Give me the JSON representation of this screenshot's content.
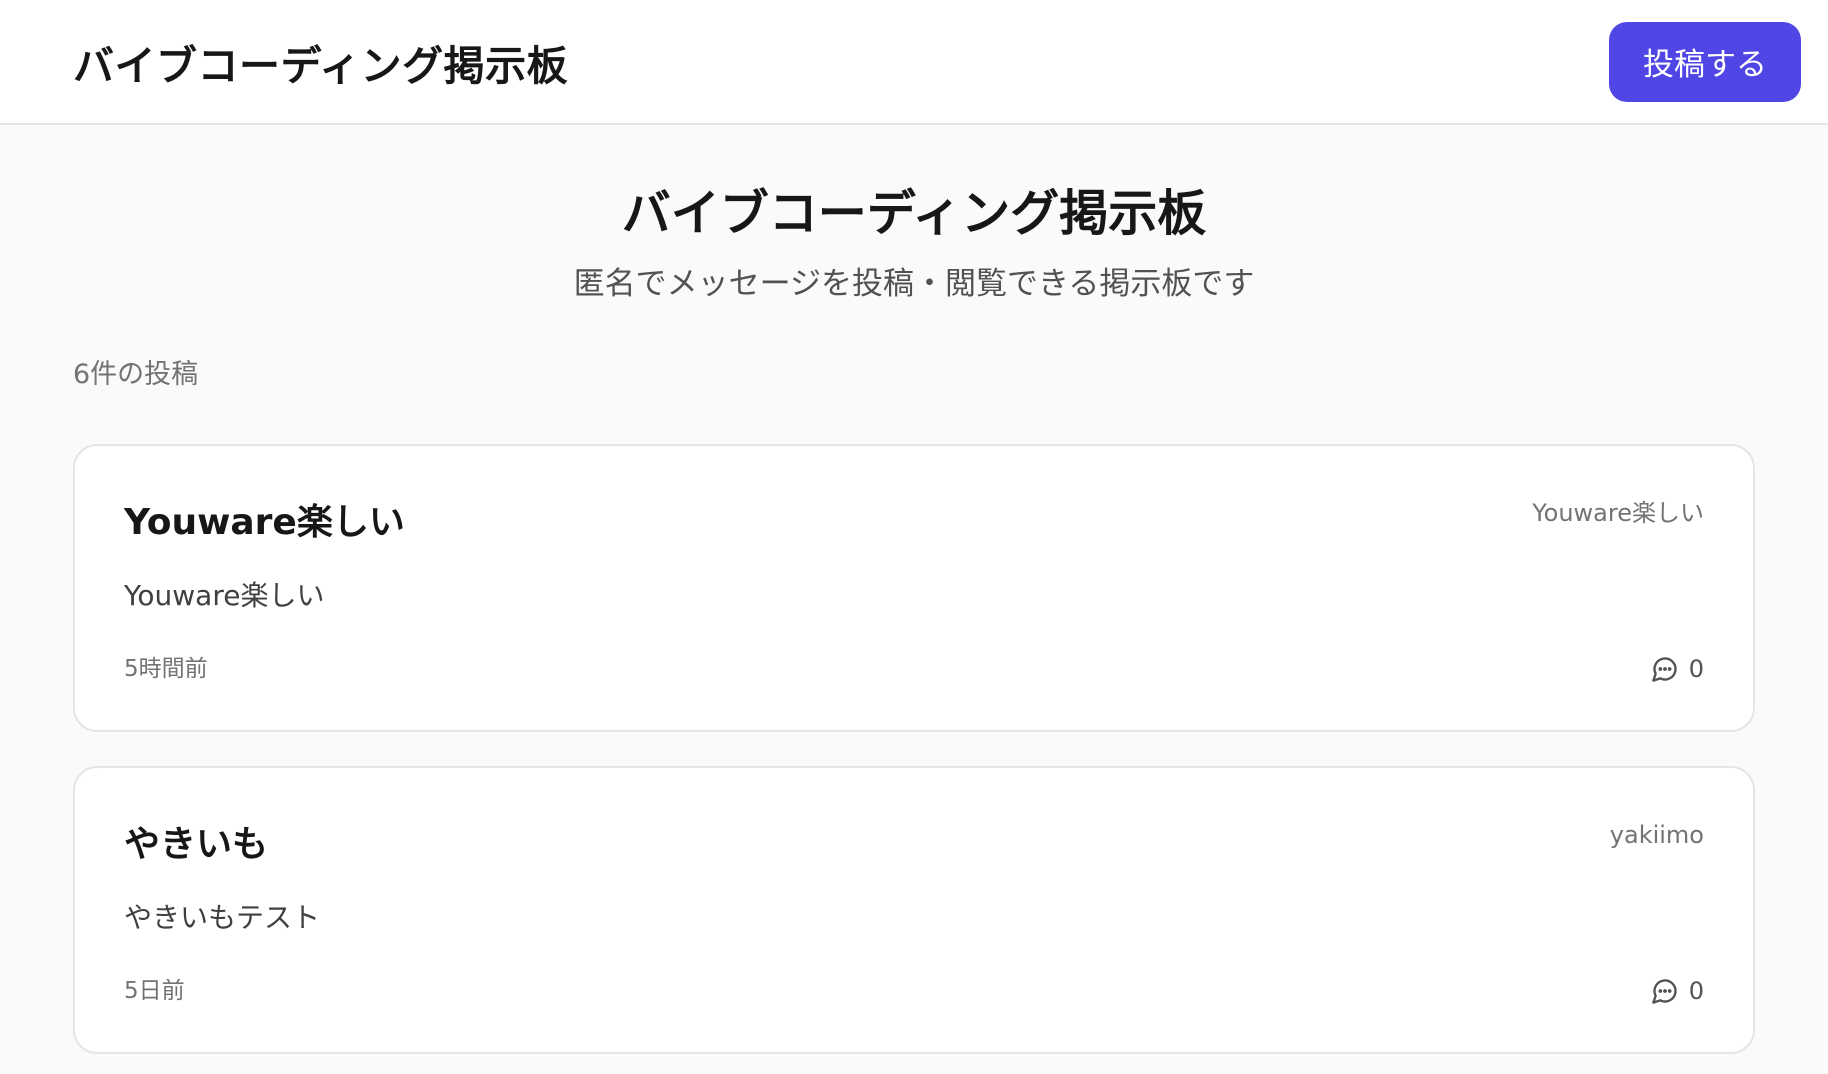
{
  "header": {
    "title": "バイブコーディング掲示板",
    "post_button_label": "投稿する"
  },
  "hero": {
    "title": "バイブコーディング掲示板",
    "subtitle": "匿名でメッセージを投稿・閲覧できる掲示板です"
  },
  "post_count_label": "6件の投稿",
  "posts": [
    {
      "title": "Youware楽しい",
      "author": "Youware楽しい",
      "body": "Youware楽しい",
      "time": "5時間前",
      "comments": "0"
    },
    {
      "title": "やきいも",
      "author": "yakiimo",
      "body": "やきいもテスト",
      "time": "5日前",
      "comments": "0"
    }
  ],
  "icons": {
    "comment": "message-circle-icon"
  },
  "colors": {
    "accent": "#4f46e5",
    "background": "#fafafa",
    "card": "#ffffff",
    "border": "#e5e5e5"
  }
}
